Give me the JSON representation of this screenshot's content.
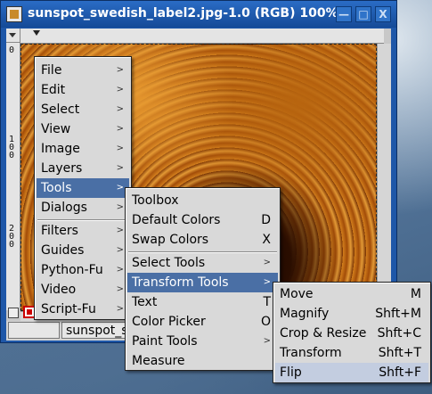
{
  "window": {
    "title": "sunspot_swedish_label2.jpg-1.0 (RGB) 100%",
    "min_glyph": "—",
    "max_glyph": "□",
    "close_glyph": "X"
  },
  "rulers": {
    "left_labels": [
      "0",
      "100",
      "200"
    ]
  },
  "status": {
    "unit_value": "",
    "text": "sunspot_s"
  },
  "main_menu": {
    "items": [
      {
        "label": "File",
        "arrow": ">"
      },
      {
        "label": "Edit",
        "arrow": ">"
      },
      {
        "label": "Select",
        "arrow": ">"
      },
      {
        "label": "View",
        "arrow": ">"
      },
      {
        "label": "Image",
        "arrow": ">"
      },
      {
        "label": "Layers",
        "arrow": ">"
      },
      {
        "label": "Tools",
        "arrow": ">"
      },
      {
        "label": "Dialogs",
        "arrow": ">"
      },
      {
        "label": "Filters",
        "arrow": ">"
      },
      {
        "label": "Guides",
        "arrow": ">"
      },
      {
        "label": "Python-Fu",
        "arrow": ">"
      },
      {
        "label": "Video",
        "arrow": ">"
      },
      {
        "label": "Script-Fu",
        "arrow": ">"
      }
    ]
  },
  "tools_menu": {
    "items": [
      {
        "label": "Toolbox",
        "shortcut": ""
      },
      {
        "label": "Default Colors",
        "shortcut": "D"
      },
      {
        "label": "Swap Colors",
        "shortcut": "X"
      },
      {
        "label": "Select Tools",
        "shortcut": ">"
      },
      {
        "label": "Transform Tools",
        "shortcut": ">"
      },
      {
        "label": "Text",
        "shortcut": "T"
      },
      {
        "label": "Color Picker",
        "shortcut": "O"
      },
      {
        "label": "Paint Tools",
        "shortcut": ">"
      },
      {
        "label": "Measure",
        "shortcut": ""
      }
    ]
  },
  "transform_menu": {
    "items": [
      {
        "label": "Move",
        "shortcut": "M"
      },
      {
        "label": "Magnify",
        "shortcut": "Shft+M"
      },
      {
        "label": "Crop & Resize",
        "shortcut": "Shft+C"
      },
      {
        "label": "Transform",
        "shortcut": "Shft+T"
      },
      {
        "label": "Flip",
        "shortcut": "Shft+F"
      }
    ]
  },
  "colors": {
    "title_bar": "#1e57a8",
    "menu_highlight": "#4a6fa5",
    "menu_bg": "#d9d9d9"
  }
}
